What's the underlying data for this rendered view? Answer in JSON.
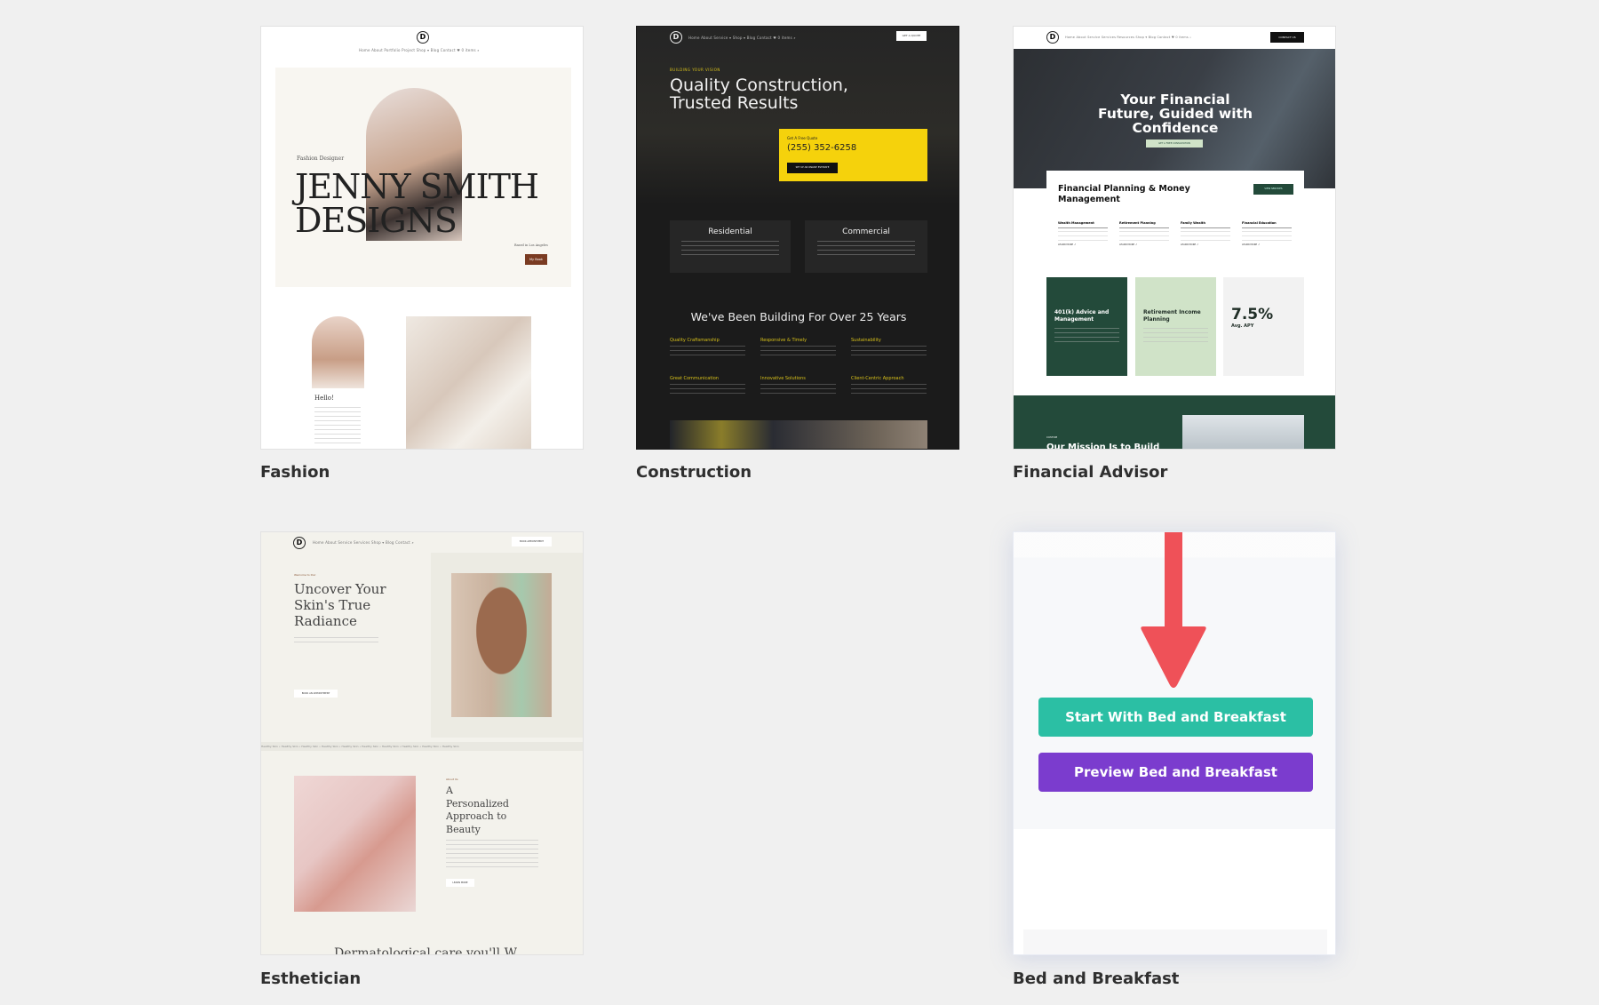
{
  "templates": [
    {
      "label": "Fashion",
      "thumb": {
        "nav": "Home  About  Portfolio  Project  Shop ▾  Blog  Contact  ♥ 0 items  ⌕",
        "eyebrow": "Fashion Designer",
        "title_line1": "JENNY SMITH",
        "title_line2": "DESIGNS",
        "location": "Based in Los Angeles",
        "button": "My Book",
        "hello": "Hello!"
      }
    },
    {
      "label": "Construction",
      "thumb": {
        "nav": "Home  About  Service ▾  Shop ▾  Blog  Contact  ♥ 0 items  ⌕",
        "nav_button": "GET A QUOTE",
        "eyebrow": "BUILDING YOUR VISION",
        "title_line1": "Quality Construction,",
        "title_line2": "Trusted Results",
        "quote_label": "Get A Free Quote",
        "phone": "(255) 352-6258",
        "quote_button": "SET UP AN ONLINE ESTIMATE",
        "service1": "Residential",
        "service2": "Commercial",
        "section_title": "We've Been Building For Over 25 Years",
        "features": [
          "Quality Craftsmanship",
          "Responsive & Timely",
          "Sustainability",
          "Great Communication",
          "Innovative Solutions",
          "Client-Centric Approach"
        ]
      }
    },
    {
      "label": "Financial Advisor",
      "thumb": {
        "nav": "Home  About  Service  Services  Resources  Shop ▾  Blog  Contact  ♥ 0 items  ⌕",
        "nav_button": "CONTACT US",
        "title": "Your Financial Future, Guided with Confidence",
        "hero_button": "GET A FREE CONSULTATION",
        "panel_title": "Financial Planning & Money Management",
        "panel_button": "VIEW SERVICES",
        "columns": [
          "Wealth Management",
          "Retirement Planning",
          "Family Wealth",
          "Financial Education"
        ],
        "learn_more": "LEARN MORE ↗",
        "box1": "401(k) Advice and Management",
        "box2": "Retirement Income Planning",
        "box3_value": "7.5%",
        "box3_label": "Avg. APY",
        "band_eyebrow": "CUSTOM",
        "band_title": "Our Mission Is to Build"
      }
    },
    {
      "label": "Esthetician",
      "thumb": {
        "nav": "Home  About  Service  Services  Shop ▾  Blog  Contact  ⌕",
        "nav_button": "BOOK APPOINTMENT",
        "eyebrow": "Welcome to Divi",
        "title": "Uncover Your Skin's True Radiance",
        "button": "BOOK AN APPOINTMENT",
        "marquee": "Healthy Skin • Healthy Skin • Healthy Skin • Healthy Skin • Healthy Skin • Healthy Skin • Healthy Skin • Healthy Skin • Healthy Skin • Healthy Skin",
        "eyebrow2": "About Us",
        "title2": "A Personalized Approach to Beauty",
        "button2": "LEARN MORE",
        "bottom_text": "Dermatological care you'll W"
      }
    },
    {
      "label": "Bed and Breakfast",
      "start_button": "Start With Bed and Breakfast",
      "preview_button": "Preview Bed and Breakfast"
    }
  ],
  "colors": {
    "start": "#2bbfa4",
    "preview": "#7b3cce",
    "arrow": "#ef5158",
    "forest": "#234a3a",
    "mint": "#d0e3c8",
    "yellow": "#f5d20c"
  }
}
